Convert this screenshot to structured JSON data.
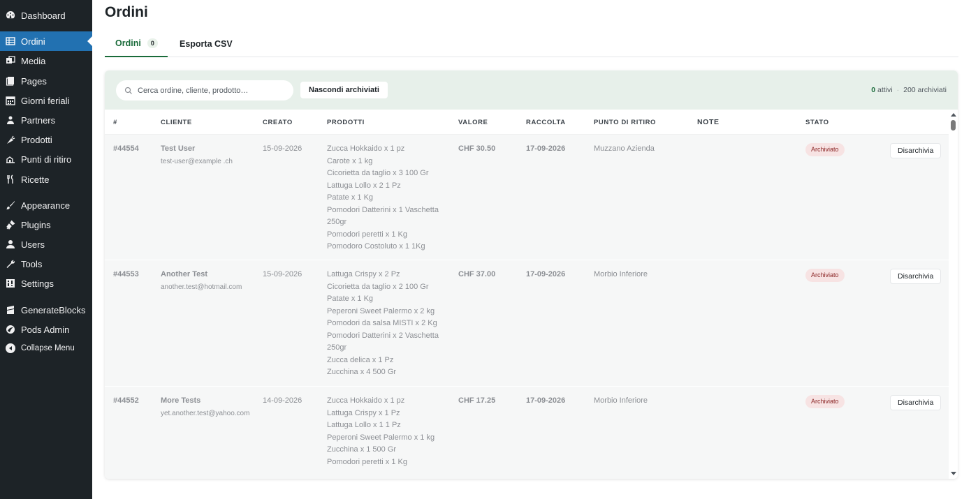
{
  "sidebar": {
    "items": [
      {
        "label": "Dashboard",
        "icon": "dashboard-icon"
      },
      {
        "label": "Ordini",
        "icon": "table-icon",
        "active": true
      },
      {
        "label": "Media",
        "icon": "media-icon"
      },
      {
        "label": "Pages",
        "icon": "pages-icon"
      },
      {
        "label": "Giorni feriali",
        "icon": "calendar-icon"
      },
      {
        "label": "Partners",
        "icon": "partners-icon"
      },
      {
        "label": "Prodotti",
        "icon": "carrot-icon"
      },
      {
        "label": "Punti di ritiro",
        "icon": "location-icon"
      },
      {
        "label": "Ricette",
        "icon": "utensils-icon"
      },
      {
        "label": "Appearance",
        "icon": "brush-icon"
      },
      {
        "label": "Plugins",
        "icon": "plugin-icon"
      },
      {
        "label": "Users",
        "icon": "user-icon"
      },
      {
        "label": "Tools",
        "icon": "wrench-icon"
      },
      {
        "label": "Settings",
        "icon": "settings-icon"
      },
      {
        "label": "GenerateBlocks",
        "icon": "blocks-icon"
      },
      {
        "label": "Pods Admin",
        "icon": "pods-icon"
      },
      {
        "label": "Collapse Menu",
        "icon": "collapse-icon"
      }
    ]
  },
  "page": {
    "title": "Ordini",
    "tabs": [
      {
        "label": "Ordini",
        "count": "0"
      },
      {
        "label": "Esporta CSV"
      }
    ]
  },
  "toolbar": {
    "search_placeholder": "Cerca ordine, cliente, prodotto…",
    "hide_button": "Nascondi archiviati",
    "active_count": "0",
    "active_label": "attivi",
    "separator": "·",
    "archived_label": "200 archiviati"
  },
  "table": {
    "headers": [
      "#",
      "CLIENTE",
      "CREATO",
      "PRODOTTI",
      "VALORE",
      "RACCOLTA",
      "PUNTO DI RITIRO",
      "NOTE",
      "STATO"
    ],
    "rows": [
      {
        "id": "#44554",
        "name": "Test User",
        "email": "test-user@example .ch",
        "created": "15-09-2026",
        "products": [
          "Zucca Hokkaido x 1 pz",
          "Carote x 1 kg",
          "Cicorietta da taglio x 3 100 Gr",
          "Lattuga Lollo x 2 1 Pz",
          "Patate x 1 Kg",
          "Pomodori Datterini x 1 Vaschetta 250gr",
          "Pomodori peretti x 1 Kg",
          "Pomodoro Costoluto x 1 1Kg"
        ],
        "value": "CHF 30.50",
        "pickup_date": "17-09-2026",
        "point": "Muzzano Azienda",
        "note": "",
        "status": "Archiviato",
        "action": "Disarchivia"
      },
      {
        "id": "#44553",
        "name": "Another Test",
        "email": "another.test@hotmail.com",
        "created": "15-09-2026",
        "products": [
          "Lattuga Crispy x 2 Pz",
          "Cicorietta da taglio x 2 100 Gr",
          "Patate x 1 Kg",
          "Peperoni Sweet Palermo x 2 kg",
          "Pomodori da salsa MISTI x 2 Kg",
          "Pomodori Datterini x 2 Vaschetta 250gr",
          "Zucca delica x 1 Pz",
          "Zucchina x 4 500 Gr"
        ],
        "value": "CHF 37.00",
        "pickup_date": "17-09-2026",
        "point": "Morbio Inferiore",
        "note": "",
        "status": "Archiviato",
        "action": "Disarchivia"
      },
      {
        "id": "#44552",
        "name": "More Tests",
        "email": "yet.another.test@yahoo.com",
        "created": "14-09-2026",
        "products": [
          "Zucca Hokkaido x 1 pz",
          "Lattuga Crispy x 1 Pz",
          "Lattuga Lollo x 1 1 Pz",
          "Peperoni Sweet Palermo x 1 kg",
          "Zucchina x 1 500 Gr",
          "Pomodori peretti x 1 Kg"
        ],
        "value": "CHF 17.25",
        "pickup_date": "17-09-2026",
        "point": "Morbio Inferiore",
        "note": "",
        "status": "Archiviato",
        "action": "Disarchivia"
      }
    ]
  },
  "colors": {
    "sidebar_bg": "#1d2327",
    "active_item": "#2271b1",
    "accent_green": "#1a6b3a",
    "toolbar_bg": "#e7f0ea",
    "badge_bg": "#f7e3e3",
    "badge_text": "#8a2424"
  }
}
